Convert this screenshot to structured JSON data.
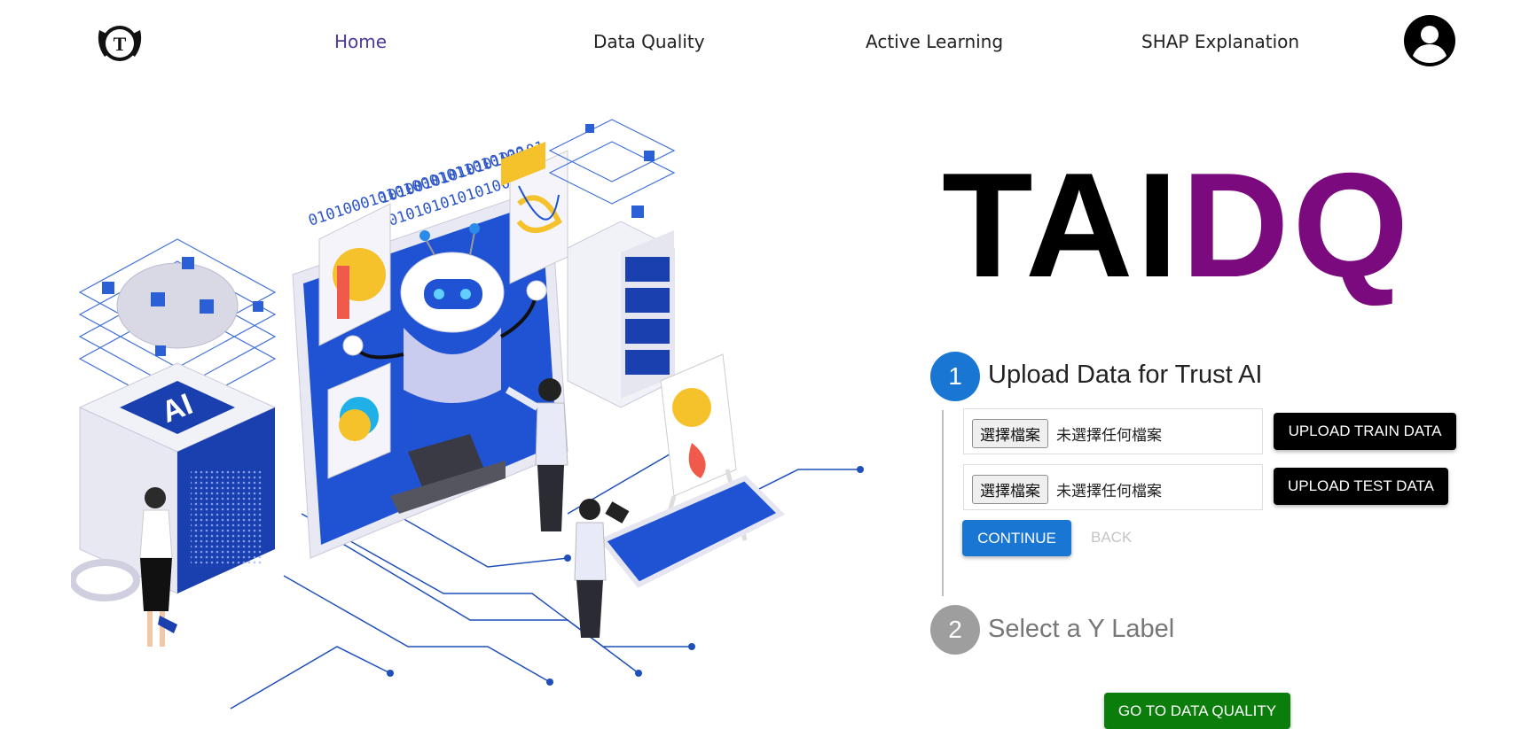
{
  "nav": {
    "links": [
      "Home",
      "Data Quality",
      "Active Learning",
      "SHAP Explanation"
    ],
    "active": "Home",
    "logo_letter": "T"
  },
  "brand": {
    "part1": "TAI",
    "part2": "DQ",
    "color1": "#000000",
    "color2": "#7a0a7e"
  },
  "illustration": {
    "binary_line1": "0101000101010001011010100",
    "binary_line2": "1010010101010101101",
    "binary_line3": "0101010101010001",
    "cube_label": "AI",
    "bubble": "?"
  },
  "stepper": {
    "steps": [
      {
        "number": "1",
        "label": "Upload Data for Trust AI",
        "state": "active",
        "color": "#1976d2"
      },
      {
        "number": "2",
        "label": "Select a Y Label",
        "state": "inactive",
        "color": "#9e9e9e"
      }
    ],
    "file_inputs": [
      {
        "button_label": "選擇檔案",
        "status": "未選擇任何檔案",
        "action_label": "UPLOAD TRAIN DATA"
      },
      {
        "button_label": "選擇檔案",
        "status": "未選擇任何檔案",
        "action_label": "UPLOAD TEST DATA"
      }
    ],
    "continue_label": "CONTINUE",
    "back_label": "BACK"
  },
  "go_button": {
    "label": "GO TO DATA QUALITY",
    "color": "#0a7d0a"
  }
}
